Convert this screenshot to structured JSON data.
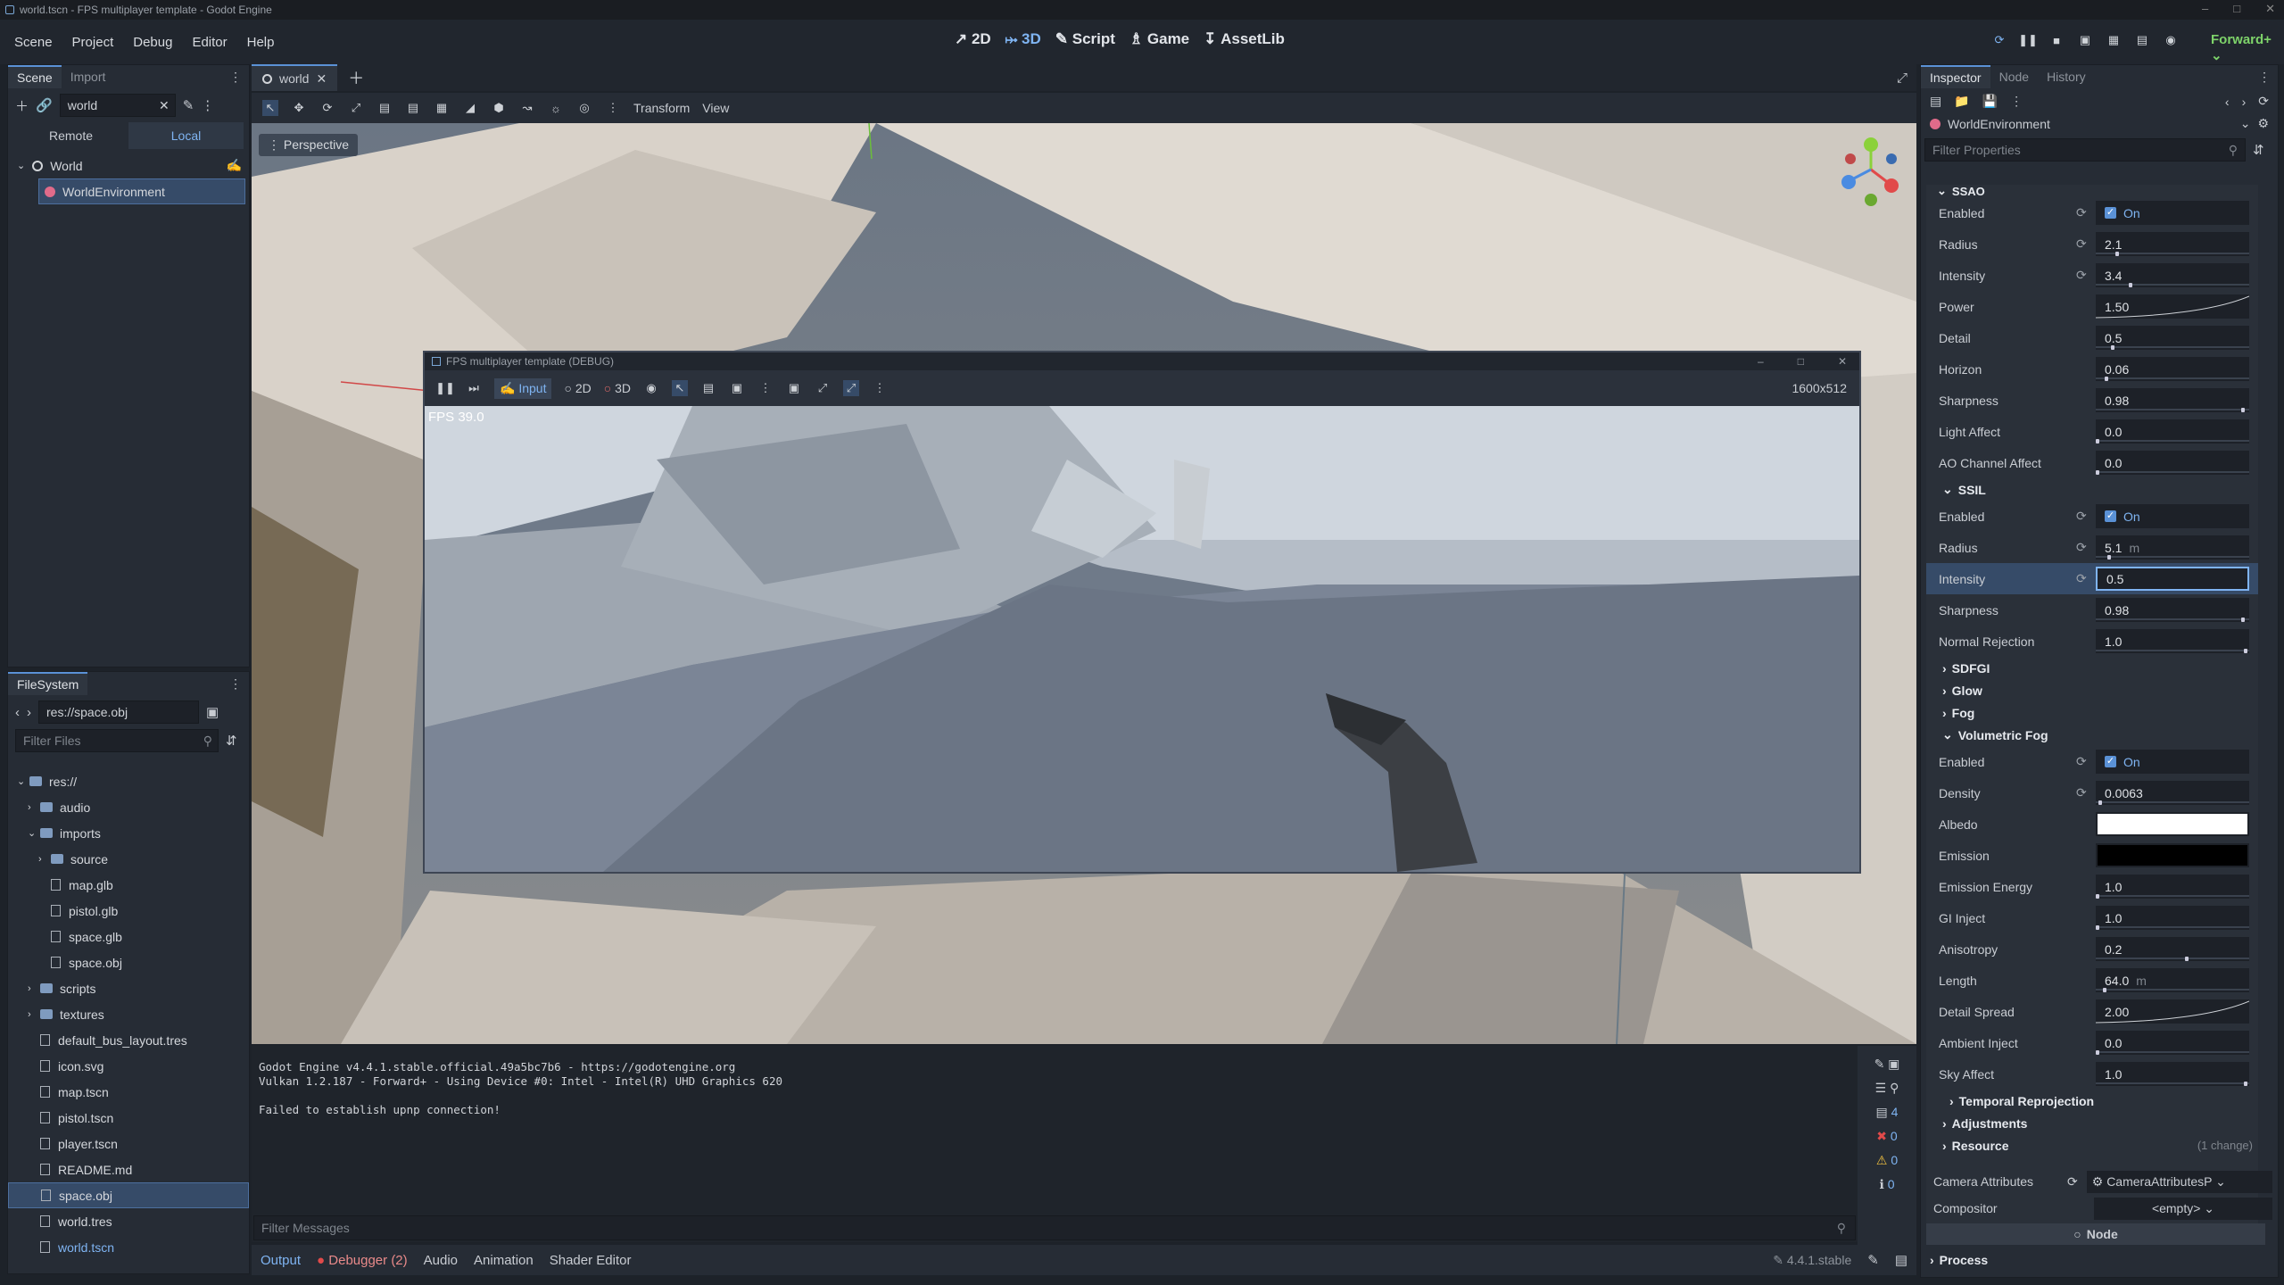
{
  "window": {
    "title": "world.tscn - FPS multiplayer template - Godot Engine"
  },
  "menu": [
    "Scene",
    "Project",
    "Debug",
    "Editor",
    "Help"
  ],
  "modes": [
    "2D",
    "3D",
    "Script",
    "Game",
    "AssetLib"
  ],
  "renderer": "Forward+",
  "scene_dock": {
    "tabs": [
      "Scene",
      "Import"
    ],
    "filter_value": "world",
    "remote_label": "Remote",
    "local_label": "Local",
    "nodes": [
      "World",
      "WorldEnvironment"
    ]
  },
  "filesystem": {
    "tab": "FileSystem",
    "path": "res://space.obj",
    "filter_placeholder": "Filter Files",
    "items": [
      {
        "name": "res://",
        "type": "folder",
        "depth": 0
      },
      {
        "name": "audio",
        "type": "folder",
        "depth": 1
      },
      {
        "name": "imports",
        "type": "folder",
        "depth": 1
      },
      {
        "name": "source",
        "type": "folder",
        "depth": 2
      },
      {
        "name": "map.glb",
        "type": "file",
        "depth": 2
      },
      {
        "name": "pistol.glb",
        "type": "file",
        "depth": 2
      },
      {
        "name": "space.glb",
        "type": "file",
        "depth": 2
      },
      {
        "name": "space.obj",
        "type": "file",
        "depth": 2
      },
      {
        "name": "scripts",
        "type": "folder",
        "depth": 1
      },
      {
        "name": "textures",
        "type": "folder",
        "depth": 1
      },
      {
        "name": "default_bus_layout.tres",
        "type": "file",
        "depth": 1
      },
      {
        "name": "icon.svg",
        "type": "file",
        "depth": 1
      },
      {
        "name": "map.tscn",
        "type": "file",
        "depth": 1
      },
      {
        "name": "pistol.tscn",
        "type": "file",
        "depth": 1
      },
      {
        "name": "player.tscn",
        "type": "file",
        "depth": 1
      },
      {
        "name": "README.md",
        "type": "file",
        "depth": 1
      },
      {
        "name": "space.obj",
        "type": "file",
        "depth": 1
      },
      {
        "name": "world.tres",
        "type": "file",
        "depth": 1
      },
      {
        "name": "world.tscn",
        "type": "file",
        "depth": 1
      }
    ]
  },
  "editor_tab": "world",
  "viewport": {
    "toolbar": [
      "Transform",
      "View"
    ],
    "perspective": "Perspective"
  },
  "game_window": {
    "title": "FPS multiplayer template (DEBUG)",
    "input_label": "Input",
    "mode_2d": "2D",
    "mode_3d": "3D",
    "resolution": "1600x512",
    "fps": "FPS 39.0"
  },
  "console": {
    "lines": [
      "Godot Engine v4.4.1.stable.official.49a5bc7b6 - https://godotengine.org",
      "Vulkan 1.2.187 - Forward+ - Using Device #0: Intel - Intel(R) UHD Graphics 620",
      "",
      "Failed to establish upnp connection!"
    ],
    "filter_placeholder": "Filter Messages",
    "counts": [
      "4",
      "0",
      "0",
      "0"
    ]
  },
  "bottom_tabs": [
    "Output",
    "Debugger (2)",
    "Audio",
    "Animation",
    "Shader Editor"
  ],
  "version": "4.4.1.stable",
  "inspector": {
    "tabs": [
      "Inspector",
      "Node",
      "History"
    ],
    "resource": "WorldEnvironment",
    "filter_placeholder": "Filter Properties",
    "ssao_title": "SSAO",
    "ssao": [
      {
        "label": "Enabled",
        "value": "On",
        "check": true,
        "revert": true
      },
      {
        "label": "Radius",
        "value": "2.1",
        "revert": true,
        "knob": 0.13
      },
      {
        "label": "Intensity",
        "value": "3.4",
        "revert": true,
        "knob": 0.22
      },
      {
        "label": "Power",
        "value": "1.50",
        "curve": true
      },
      {
        "label": "Detail",
        "value": "0.5",
        "knob": 0.1
      },
      {
        "label": "Horizon",
        "value": "0.06",
        "knob": 0.06
      },
      {
        "label": "Sharpness",
        "value": "0.98",
        "knob": 0.98
      },
      {
        "label": "Light Affect",
        "value": "0.0",
        "knob": 0
      },
      {
        "label": "AO Channel Affect",
        "value": "0.0",
        "knob": 0
      }
    ],
    "ssil_title": "SSIL",
    "ssil": [
      {
        "label": "Enabled",
        "value": "On",
        "check": true,
        "revert": true
      },
      {
        "label": "Radius",
        "value": "5.1",
        "unit": "m",
        "revert": true,
        "knob": 0.08
      },
      {
        "label": "Intensity",
        "value": "0.5",
        "revert": true,
        "selected": true
      },
      {
        "label": "Sharpness",
        "value": "0.98",
        "knob": 0.98
      },
      {
        "label": "Normal Rejection",
        "value": "1.0",
        "knob": 1
      }
    ],
    "collapsed": [
      "SDFGI",
      "Glow",
      "Fog"
    ],
    "vfog_title": "Volumetric Fog",
    "vfog": [
      {
        "label": "Enabled",
        "value": "On",
        "check": true,
        "revert": true
      },
      {
        "label": "Density",
        "value": "0.0063",
        "revert": true,
        "knob": 0.02
      },
      {
        "label": "Albedo",
        "color": "#ffffff"
      },
      {
        "label": "Emission",
        "color": "#000000"
      },
      {
        "label": "Emission Energy",
        "value": "1.0",
        "knob": 0
      },
      {
        "label": "GI Inject",
        "value": "1.0",
        "knob": 0
      },
      {
        "label": "Anisotropy",
        "value": "0.2",
        "knob": 0.6
      },
      {
        "label": "Length",
        "value": "64.0",
        "unit": "m",
        "knob": 0.05
      },
      {
        "label": "Detail Spread",
        "value": "2.00",
        "curve": true
      },
      {
        "label": "Ambient Inject",
        "value": "0.0",
        "knob": 0
      },
      {
        "label": "Sky Affect",
        "value": "1.0",
        "knob": 1
      }
    ],
    "after": [
      "Temporal Reprojection",
      "Adjustments",
      "Resource"
    ],
    "resource_changes": "(1 change)",
    "camera_attributes_label": "Camera Attributes",
    "camera_attributes_value": "CameraAttributesP",
    "compositor_label": "Compositor",
    "compositor_value": "<empty>",
    "node_header": "Node",
    "process": "Process"
  }
}
